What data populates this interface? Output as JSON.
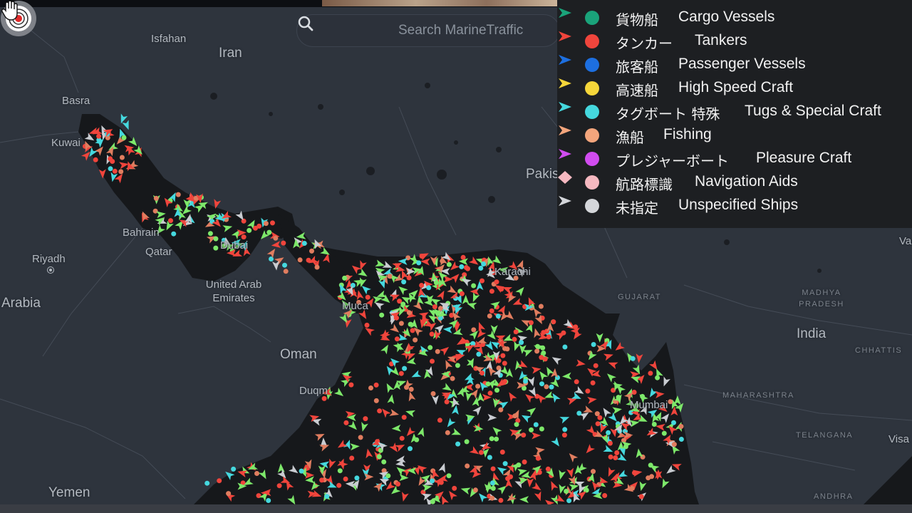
{
  "search": {
    "placeholder": "Search MarineTraffic",
    "icon": "search-icon"
  },
  "legend": [
    {
      "jp": "貨物船",
      "en": "Cargo Vessels",
      "color": "#1aa37a",
      "arrow_color": "#1aa37a",
      "shape": "circle"
    },
    {
      "jp": "タンカー",
      "en": "Tankers",
      "color": "#f0453c",
      "arrow_color": "#f0453c",
      "shape": "circle"
    },
    {
      "jp": "旅客船",
      "en": "Passenger Vessels",
      "color": "#1d6fe0",
      "arrow_color": "#1d6fe0",
      "shape": "circle"
    },
    {
      "jp": "高速船",
      "en": "High Speed Craft",
      "color": "#f5d63a",
      "arrow_color": "#f5d63a",
      "shape": "circle"
    },
    {
      "jp": "タグボート 特殊",
      "en": "Tugs & Special Craft",
      "color": "#45d8de",
      "arrow_color": "#45d8de",
      "shape": "circle"
    },
    {
      "jp": "漁船",
      "en": "Fishing",
      "color": "#f3a57c",
      "arrow_color": "#f3a57c",
      "shape": "circle"
    },
    {
      "jp": "プレジャーボート",
      "en": "Pleasure Craft",
      "color": "#d14cf0",
      "arrow_color": "#d14cf0",
      "shape": "circle"
    },
    {
      "jp": "航路標識",
      "en": "Navigation Aids",
      "color": "#f5b8c0",
      "arrow_color": "#f5b8c0",
      "shape": "diamond"
    },
    {
      "jp": "未指定",
      "en": "Unspecified Ships",
      "color": "#d4d6da",
      "arrow_color": "#d4d6da",
      "shape": "circle"
    }
  ],
  "map_labels": {
    "iran": "Iran",
    "isfahan": "Isfahan",
    "basra": "Basra",
    "kuwait": "Kuwai",
    "bahrain": "Bahrain",
    "qatar": "Qatar",
    "riyadh": "Riyadh",
    "arabia": "Arabia",
    "dubai": "Dubai",
    "uae": "United Arab Emirates",
    "oman": "Oman",
    "muscat": "Muca",
    "duqm": "Duqm",
    "yemen": "Yemen",
    "pakistan": "Pakis",
    "karachi": "Karachi",
    "gujarat": "GUJARAT",
    "madhya": "MADHYA PRADESH",
    "india": "India",
    "chhattis": "CHHATTIS",
    "maharashtra": "MAHARASHTRA",
    "mumbai": "Mumbai",
    "telangana": "TELANGANA",
    "andhra": "ANDHRA",
    "visa": "Visa",
    "va": "Va"
  },
  "colors": {
    "land": "#2e343d",
    "sea": "#16181b",
    "border": "#454c57",
    "cargo": "#7de86a",
    "tanker": "#f0453c",
    "fishing": "#e07d5f",
    "tug": "#45d8de",
    "unspecified": "#c9ccd1"
  }
}
